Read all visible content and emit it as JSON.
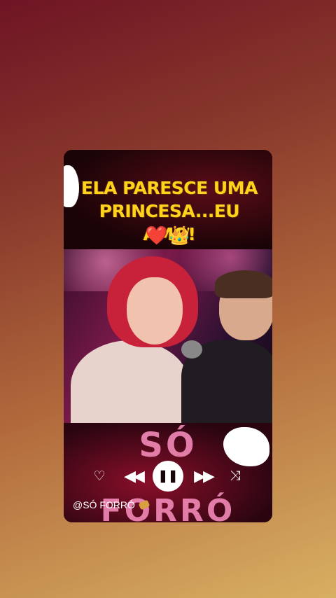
{
  "caption": {
    "line1": "ELA PARESCE UMA",
    "line2": "PRINCESA...EU AMO!",
    "emojis": [
      "❤️",
      "👑"
    ]
  },
  "brand": {
    "word1": "SÓ",
    "word2": "FORRÓ"
  },
  "player": {
    "handle": "@SÓ FORRÓ",
    "icons": [
      "heart-outline-icon",
      "rewind-icon",
      "pause-icon",
      "fast-forward-icon",
      "shuffle-icon"
    ]
  }
}
